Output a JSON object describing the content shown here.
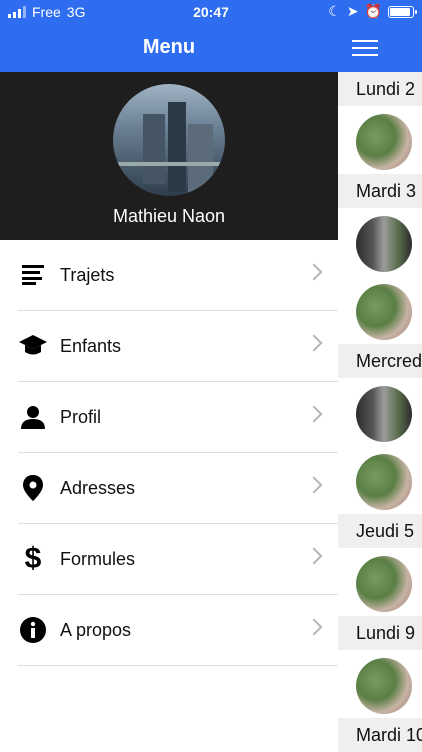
{
  "status_bar": {
    "carrier": "Free",
    "network": "3G",
    "time": "20:47",
    "battery_level": 0.85,
    "icons": [
      "signal-icon",
      "moon-icon",
      "location-arrow-icon",
      "alarm-icon",
      "battery-icon"
    ]
  },
  "drawer": {
    "title": "Menu",
    "user_name": "Mathieu Naon",
    "items": [
      {
        "label": "Trajets",
        "icon": "list-icon"
      },
      {
        "label": "Enfants",
        "icon": "graduation-cap-icon"
      },
      {
        "label": "Profil",
        "icon": "user-icon"
      },
      {
        "label": "Adresses",
        "icon": "map-pin-icon"
      },
      {
        "label": "Formules",
        "icon": "dollar-icon"
      },
      {
        "label": "A propos",
        "icon": "info-icon"
      }
    ]
  },
  "calendar": {
    "days": [
      {
        "label": "Lundi 2"
      },
      {
        "label": "Mardi 3"
      },
      {
        "label": "Mercredi"
      },
      {
        "label": "Jeudi 5"
      },
      {
        "label": "Lundi 9"
      },
      {
        "label": "Mardi 10"
      }
    ]
  },
  "colors": {
    "accent": "#2f6df0",
    "profile_bg": "#1e1e1e"
  }
}
